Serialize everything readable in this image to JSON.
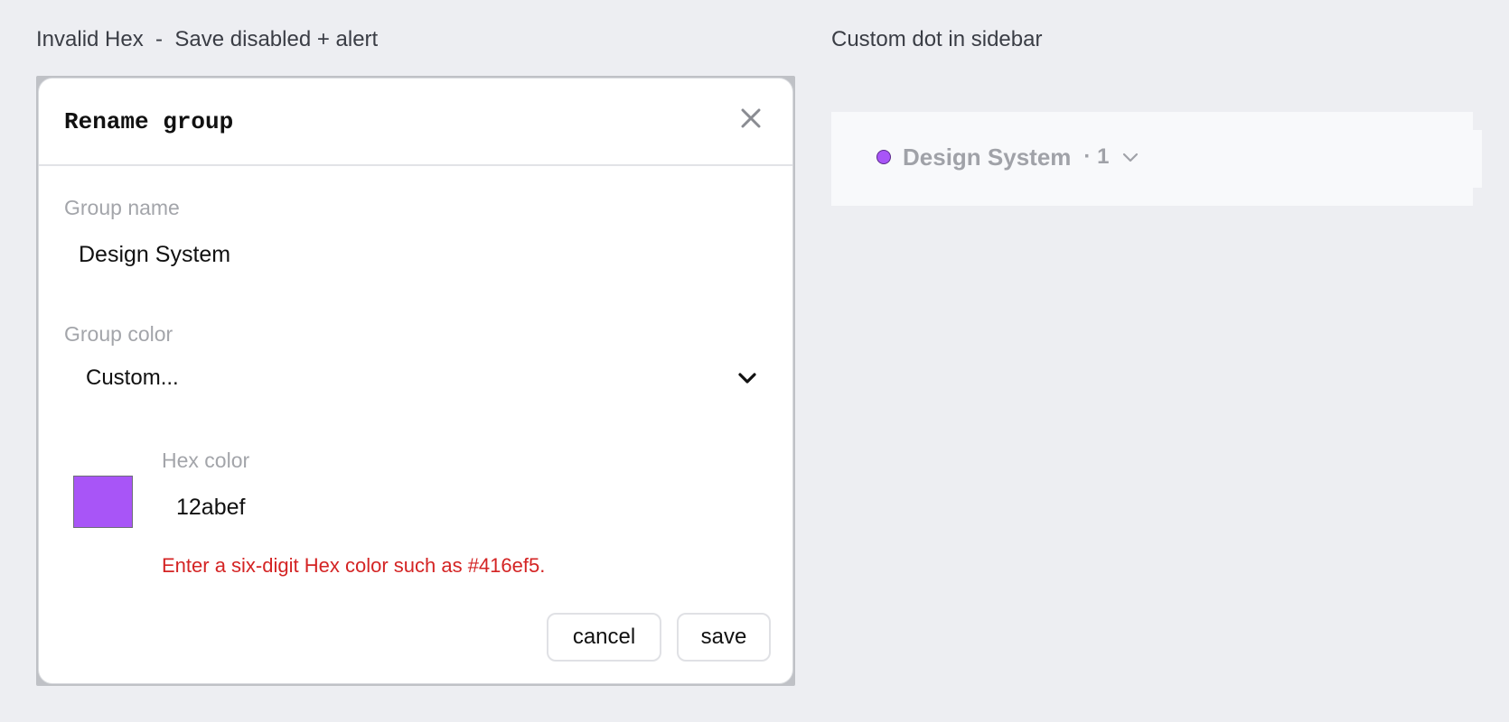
{
  "captions": {
    "left": "Invalid Hex  -  Save disabled + alert",
    "right": "Custom dot in sidebar"
  },
  "dialog": {
    "title": "Rename group",
    "close_icon": "close-icon",
    "group_name_label": "Group name",
    "group_name_value": "Design System",
    "group_color_label": "Group color",
    "group_color_selected": "Custom...",
    "hex_label": "Hex color",
    "hex_value": "12abef",
    "swatch_color": "#a855f7",
    "error_message": "Enter a six-digit Hex color such as #416ef5.",
    "error_color": "#d42424",
    "cancel_label": "cancel",
    "save_label": "save"
  },
  "sidebar": {
    "group_name": "Design System",
    "group_count": "· 1",
    "dot_color": "#a855f7",
    "chevron_icon": "chevron-down-icon"
  }
}
